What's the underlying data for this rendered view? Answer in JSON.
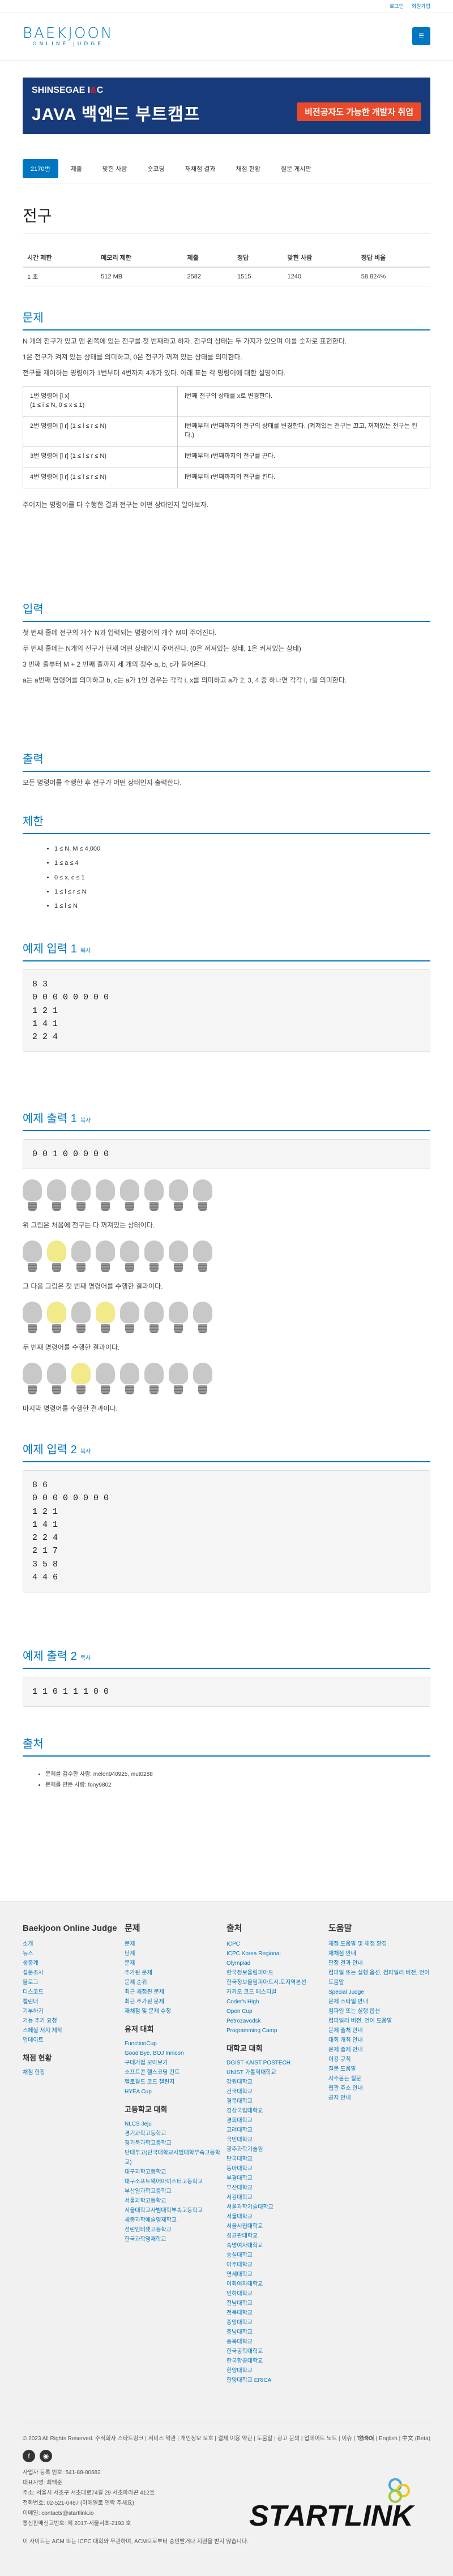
{
  "topbar": {
    "login": "로그인",
    "signup": "회원가입"
  },
  "logo": {
    "main": "BAEKJOON",
    "sub": "ONLINE JUDGE"
  },
  "banner": {
    "brand_pre": "SHINSEGAE I",
    "brand_amp": "&",
    "brand_post": "C",
    "headline": "JAVA 백엔드 부트캠프",
    "cta": "비전공자도 가능한 개발자 취업"
  },
  "tabs": [
    "2170번",
    "제출",
    "맞힌 사람",
    "숏코딩",
    "재채점 결과",
    "채점 현황",
    "질문 게시판"
  ],
  "title": "전구",
  "info": {
    "headers": [
      "시간 제한",
      "메모리 제한",
      "제출",
      "정답",
      "맞힌 사람",
      "정답 비율"
    ],
    "values": [
      "1 초",
      "512 MB",
      "2582",
      "1515",
      "1240",
      "58.824%"
    ]
  },
  "sec_problem": "문제",
  "problem": [
    "N 개의 전구가 있고 맨 왼쪽에 있는 전구를 첫 번째라고 하자. 전구의 상태는 두 가지가 있으며 이를 숫자로 표현한다.",
    "1은 전구가 켜져 있는 상태를 의미하고, 0은 전구가 꺼져 있는 상태를 의미한다.",
    "전구를 제어하는 명령어가 1번부터 4번까지 4개가 있다. 아래 표는 각 명령어에 대한 설명이다."
  ],
  "commands": [
    {
      "cmd": "1번 명령어 [i x]",
      "cond": "(1 ≤ i ≤ N, 0 ≤ x ≤ 1)",
      "desc": "i번째 전구의 상태를 x로 변경한다."
    },
    {
      "cmd": "2번 명령어 [l r]",
      "cond": "(1 ≤ l ≤ r ≤ N)",
      "desc": "l번째부터 r번째까지의 전구의 상태를 변경한다. (켜져있는 전구는 끄고, 꺼져있는 전구는 킨다.)"
    },
    {
      "cmd": "3번 명령어 [l r]",
      "cond": "(1 ≤ l ≤ r ≤ N)",
      "desc": "l번째부터 r번째까지의 전구를 끈다."
    },
    {
      "cmd": "4번 명령어 [l r]",
      "cond": "(1 ≤ l ≤ r ≤ N)",
      "desc": "l번째부터 r번째까지의 전구를 킨다."
    }
  ],
  "problem_end": "주어지는 명령어를 다 수행한 결과 전구는 어떤 상태인지 알아보자.",
  "sec_input": "입력",
  "input": [
    "첫 번째 줄에 전구의 개수 N과 입력되는 명령어의 개수 M이 주어진다.",
    "두 번째 줄에는 N개의 전구가 현재 어떤 상태인지 주어진다. (0은 꺼져있는 상태, 1은 켜져있는 상태)",
    "3 번째 줄부터 M + 2 번째 줄까지 세 개의 정수 a, b, c가 들어온다.",
    "a는 a번째 명령어를 의미하고 b, c는 a가 1인 경우는 각각 i, x를 의미하고 a가 2, 3, 4 중 하나면 각각 l, r을 의미한다."
  ],
  "sec_output": "출력",
  "output": "모든 명령어를 수행한 후 전구가 어떤 상태인지 출력한다.",
  "sec_limit": "제한",
  "limits": [
    "1 ≤ N, M ≤ 4,000",
    "1 ≤ a ≤ 4",
    "0 ≤ x, c ≤ 1",
    "1 ≤ l ≤ r ≤ N",
    "1 ≤ i ≤ N"
  ],
  "sample1_in_title": "예제 입력 1",
  "copy": "복사",
  "sample1_in": "8 3\n0 0 0 0 0 0 0 0\n1 2 1\n1 4 1\n2 2 4",
  "sample1_out_title": "예제 출력 1",
  "sample1_out": "0 0 1 0 0 0 0 0",
  "note1": "위 그림은 처음에 전구는 다 꺼져있는 상태이다.",
  "note2": "그 다음 그림은 첫 번째 명령어를 수행한 결과이다.",
  "note3": "두 번째 명령어를 수행한 결과이다.",
  "note4": "마지막 명령어를 수행한 결과이다.",
  "bulb_rows": [
    [
      0,
      0,
      0,
      0,
      0,
      0,
      0,
      0
    ],
    [
      0,
      1,
      0,
      0,
      0,
      0,
      0,
      0
    ],
    [
      0,
      1,
      0,
      1,
      0,
      0,
      0,
      0
    ],
    [
      0,
      0,
      1,
      0,
      0,
      0,
      0,
      0
    ]
  ],
  "sample2_in_title": "예제 입력 2",
  "sample2_in": "8 6\n0 0 0 0 0 0 0 0\n1 2 1\n1 4 1\n2 2 4\n2 1 7\n3 5 8\n4 4 6",
  "sample2_out_title": "예제 출력 2",
  "sample2_out": "1 1 0 1 1 1 0 0",
  "sec_source": "출처",
  "source": [
    "문제를 검수한 사람: melon940925, mut0288",
    "문제를 만든 사람: fony9802"
  ],
  "footer": {
    "col1": {
      "title": "Baekjoon Online Judge",
      "items": [
        "소개",
        "뉴스",
        "생중계",
        "설문조사",
        "블로그",
        "디스코드",
        "캘린더",
        "기부하기",
        "기능 추가 요청",
        "스페셜 저지 제작",
        "업데이트"
      ],
      "sub": "채점 현황",
      "sub_items": [
        "채점 현황"
      ]
    },
    "col2": {
      "title": "문제",
      "items": [
        "문제",
        "단계",
        "문제",
        "추가된 문제",
        "문제 순위",
        "최근 채점된 문제",
        "최근 추가된 문제",
        "재채점 및 문제 수정"
      ],
      "sub": "유저 대회",
      "sub_items": [
        "FunctionCup",
        "Good Bye, BOJ Innicon",
        "구데기컵 모아보기",
        "소프트콘 헬스코딩 컨트",
        "헬로월드 코드 챌린지",
        "HYEA Cup"
      ],
      "sub2": "고등학교 대회",
      "sub2_items": [
        "NLCS Jeju",
        "경기과학고등학교",
        "경기북과학고등학교",
        "단대부고(단국대학교사범대학부속고등학교)",
        "대구과학고등학교",
        "대구소프트웨어마이스터고등학교",
        "부산일과학고등학교",
        "서울과학고등학교",
        "서울대학교사범대학부속고등학교",
        "세종과학예술영재학교",
        "선린인터넷고등학교",
        "한국과학영재학교"
      ]
    },
    "col3": {
      "title": "출처",
      "items": [
        "ICPC",
        "ICPC Korea Regional",
        "Olympiad",
        "한국정보올림피아드",
        "한국정보올림피아드시.도지역본선",
        "카카오 코드 페스티벌",
        "Coder's High",
        "Open Cup",
        "Petrozavodsk",
        "Programming Camp"
      ],
      "sub": "대학교 대회",
      "sub_items": [
        "DGIST KAIST POSTECH",
        "UNIST 가톨릭대학교",
        "강원대학교",
        "건국대학교",
        "경북대학교",
        "경상국립대학교",
        "경희대학교",
        "고려대학교",
        "국민대학교",
        "광주과학기술원",
        "단국대학교",
        "동아대학교",
        "부경대학교",
        "부산대학교",
        "서강대학교",
        "서울과학기술대학교",
        "서울대학교",
        "서울시립대학교",
        "성균관대학교",
        "숙명여자대학교",
        "숭실대학교",
        "아주대학교",
        "연세대학교",
        "이화여자대학교",
        "인하대학교",
        "전남대학교",
        "전북대학교",
        "중앙대학교",
        "충남대학교",
        "충북대학교",
        "한국공학대학교",
        "한국항공대학교",
        "한양대학교",
        "한양대학교 ERICA"
      ]
    },
    "col4": {
      "title": "도움말",
      "items": [
        "채점 도움말 및 채점 환경",
        "재채점 안내",
        "판정 결과 안내",
        "컴파일 또는 실행 옵션, 컴파일러 버전, 언어 도움말",
        "Special Judge",
        "문제 스타일 안내",
        "컴파일 또는 실행 옵션",
        "컴파일러 버전, 언어 도움말",
        "문제 출처 안내",
        "대회 개최 안내",
        "문제 출제 안내",
        "이용 규칙",
        "질문 도움말",
        "자주묻는 질문",
        "웹관 주소 안내",
        "공지 안내"
      ]
    },
    "copyright": "© 2023 All Rights Reserved. 주식회사 스타트링크",
    "links": "서비스 약관 | 개인정보 보호 | 결제 이용 약관 | 도움말 | 광고 문의 | 업데이트 노트 | 이슈 | TODO",
    "lang": "한국어 | English | 中文 (Beta)",
    "company": [
      "사업자 등록 번호: 541-88-00682",
      "대표자명: 최백준",
      "주소: 서울시 서초구 서초대로74길 29 서초파라곤 412호",
      "전화번호: 02-521-0487 (이메일로 연락 주세요)",
      "이메일: contacts@startlink.io",
      "통신판매신고번호: 제 2017-서울서초-2193 호"
    ],
    "icpc": "이 사이트는 ACM 또는 ICPC 대회와 무관하며, ACM으로부터 승인받거나 지원을 받지 않습니다.",
    "startlink": "STARTLINK"
  }
}
